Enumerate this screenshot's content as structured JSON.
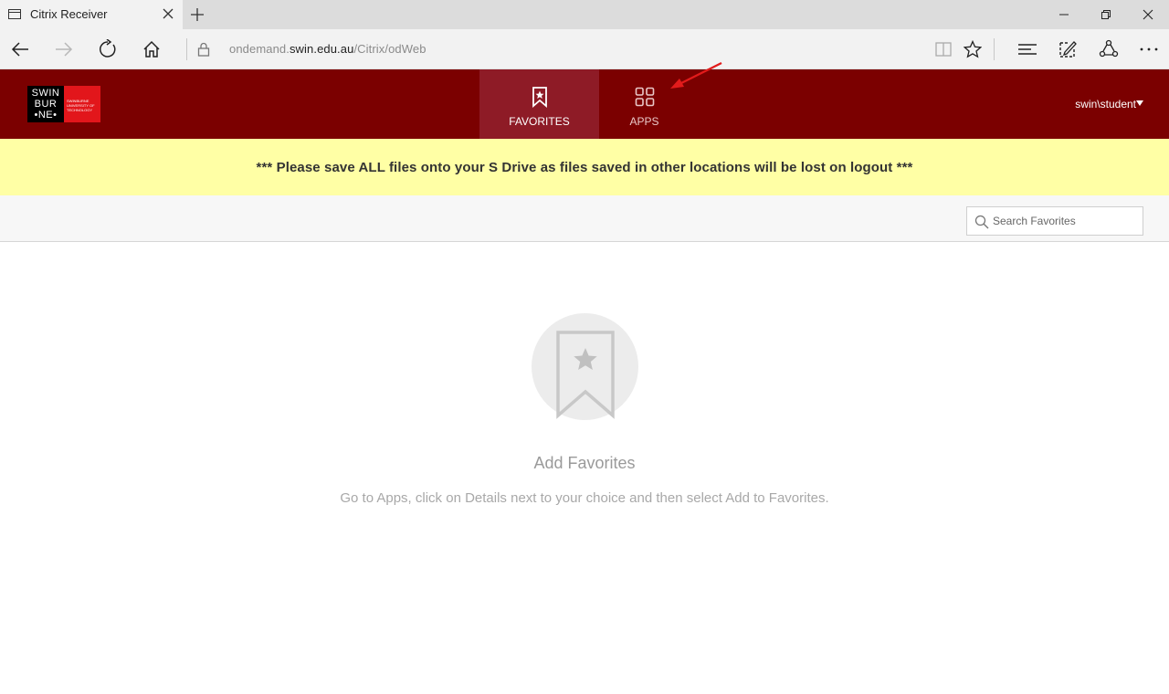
{
  "browser": {
    "tab_title": "Citrix Receiver",
    "url_prefix": "ondemand.",
    "url_host": "swin.edu.au",
    "url_path": "/Citrix/odWeb"
  },
  "header": {
    "logo_lines": [
      "SWIN",
      "BUR",
      "•NE•"
    ],
    "logo_subtext": "SWINBURNE UNIVERSITY OF TECHNOLOGY",
    "tabs": [
      {
        "label": "FAVORITES"
      },
      {
        "label": "APPS"
      }
    ],
    "user": "swin\\student"
  },
  "banner": {
    "text": "*** Please save ALL files onto your S Drive as files saved in other locations will be lost on logout ***"
  },
  "search": {
    "placeholder": "Search Favorites"
  },
  "empty_state": {
    "title": "Add Favorites",
    "description": "Go to Apps, click on Details next to your choice and then select Add to Favorites."
  },
  "colors": {
    "header_bg": "#7b0000",
    "active_tab_bg": "#8e1b26",
    "banner_bg": "#ffffa5",
    "annotation_arrow": "#e21b1b"
  }
}
